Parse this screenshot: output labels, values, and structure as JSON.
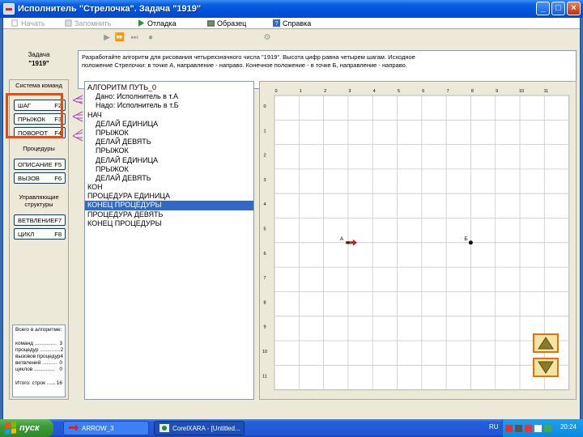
{
  "window": {
    "title": "Исполнитель \"Стрелочка\".  Задача  \"1919\""
  },
  "menu": {
    "items": [
      {
        "label": "Начать",
        "enabled": false
      },
      {
        "label": "Запомнить",
        "enabled": false
      },
      {
        "label": "Отладка",
        "enabled": true
      },
      {
        "label": "Образец",
        "enabled": true
      },
      {
        "label": "Справка",
        "enabled": true
      }
    ]
  },
  "toolbar": {
    "icons": [
      "run-icon",
      "step-icon",
      "step-over-icon",
      "stop-icon",
      "debug-tool-icon"
    ]
  },
  "task": {
    "label": "Задача",
    "number": "\"1919\"",
    "description_line1": "Разработайте алгоритм для рисования четырехзначного числа \"1919\". Высота цифр равна четырем шагам. Исходное",
    "description_line2": "положение Стрелочки: в точке А, направление - направо. Конечное положение - в  точке Б, направление - направо."
  },
  "commands": {
    "system_label": "Система команд",
    "step": {
      "label": "ШАГ",
      "key": "F2"
    },
    "jump": {
      "label": "ПРЫЖОК",
      "key": "F3"
    },
    "turn": {
      "label": "ПОВОРОТ",
      "key": "F4"
    },
    "procedures_label": "Процедуры",
    "describe": {
      "label": "ОПИСАНИЕ",
      "key": "F5"
    },
    "call": {
      "label": "ВЫЗОВ",
      "key": "F6"
    },
    "control_label": "Управляющие структуры",
    "branch": {
      "label": "ВЕТВЛЕНИЕ",
      "key": "F7"
    },
    "loop": {
      "label": "ЦИКЛ",
      "key": "F8"
    }
  },
  "stats": {
    "heading": "Всего в алгоритме:",
    "commands": {
      "label": "команд",
      "dots": "...............",
      "value": "3"
    },
    "procedures": {
      "label": "процедур",
      "dots": "..............",
      "value": "2"
    },
    "calls": {
      "label": "вызовов процедур",
      "dots": "",
      "value": "4"
    },
    "branches": {
      "label": "ветвлений",
      "dots": "..........",
      "value": "0"
    },
    "loops": {
      "label": "циклов",
      "dots": "..............",
      "value": "0"
    },
    "total": {
      "label": "Итого:  строк",
      "dots": "......",
      "value": "16"
    }
  },
  "algorithm": {
    "lines": [
      {
        "text": "АЛГОРИТМ ПУТЬ_0",
        "indent": 0
      },
      {
        "text": "Дано: Исполнитель в т.А",
        "indent": 1
      },
      {
        "text": "Надо: Исполнитель в т.Б",
        "indent": 1
      },
      {
        "text": "НАЧ",
        "indent": 0
      },
      {
        "text": "ДЕЛАЙ ЕДИНИЦА",
        "indent": 1
      },
      {
        "text": "ПРЫЖОК",
        "indent": 1
      },
      {
        "text": "ДЕЛАЙ ДЕВЯТЬ",
        "indent": 1
      },
      {
        "text": "ПРЫЖОК",
        "indent": 1
      },
      {
        "text": "ДЕЛАЙ ЕДИНИЦА",
        "indent": 1
      },
      {
        "text": "ПРЫЖОК",
        "indent": 1
      },
      {
        "text": "ДЕЛАЙ ДЕВЯТЬ",
        "indent": 1
      },
      {
        "text": "КОН",
        "indent": 0
      },
      {
        "text": "ПРОЦЕДУРА ЕДИНИЦА",
        "indent": 0
      },
      {
        "text": "КОНЕЦ ПРОЦЕДУРЫ",
        "indent": 0,
        "selected": true
      },
      {
        "text": "ПРОЦЕДУРА ДЕВЯТЬ",
        "indent": 0
      },
      {
        "text": "КОНЕЦ ПРОЦЕДУРЫ",
        "indent": 0
      }
    ]
  },
  "field": {
    "x_ticks": [
      "0",
      "1",
      "2",
      "3",
      "4",
      "5",
      "6",
      "7",
      "8",
      "9",
      "10",
      "11"
    ],
    "y_ticks": [
      "0",
      "1",
      "2",
      "3",
      "4",
      "5",
      "6",
      "7",
      "8",
      "9",
      "10",
      "11"
    ],
    "point_a": {
      "label": "А",
      "col": 3,
      "row": 6
    },
    "point_b": {
      "label": "Б",
      "col": 8,
      "row": 6
    },
    "grid_color": "#c8c8c8",
    "arrow_color": "#c81e1e"
  },
  "nav": {
    "up_icon": "triangle-up-icon",
    "down_icon": "triangle-down-icon"
  },
  "taskbar": {
    "start_label": "пуск",
    "tasks": [
      {
        "label": "ARROW_3"
      },
      {
        "label": "CorelXARA - [Untitled..."
      }
    ],
    "language": "RU",
    "clock": "20:24"
  }
}
